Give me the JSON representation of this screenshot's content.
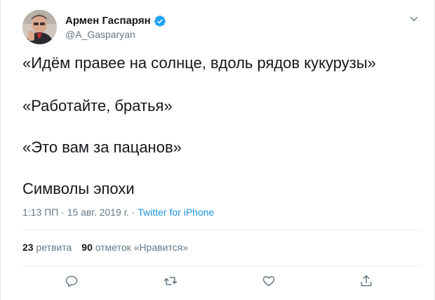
{
  "user": {
    "display_name": "Армен Гаспарян",
    "handle": "@A_Gasparyan",
    "verified": true
  },
  "tweet": {
    "lines": [
      "«Идём правее на солнце, вдоль рядов кукурузы»",
      "«Работайте, братья»",
      "«Это вам за пацанов»",
      "Символы эпохи"
    ],
    "time": "1:13 ПП",
    "separator1": " · ",
    "date": "15 авг. 2019 г.",
    "separator2": " · ",
    "source": "Twitter for iPhone"
  },
  "stats": {
    "retweets_count": "23",
    "retweets_label": "ретвита",
    "likes_count": "90",
    "likes_label": "отметок «Нравится»"
  },
  "icons": {
    "reply": "reply-icon",
    "retweet": "retweet-icon",
    "like": "heart-icon",
    "share": "share-icon",
    "more": "chevron-down-icon",
    "verified": "verified-badge-icon"
  },
  "colors": {
    "text": "#14171a",
    "secondary": "#657786",
    "link": "#1b95e0",
    "verified": "#1da1f2",
    "divider": "#e6ecf0"
  }
}
